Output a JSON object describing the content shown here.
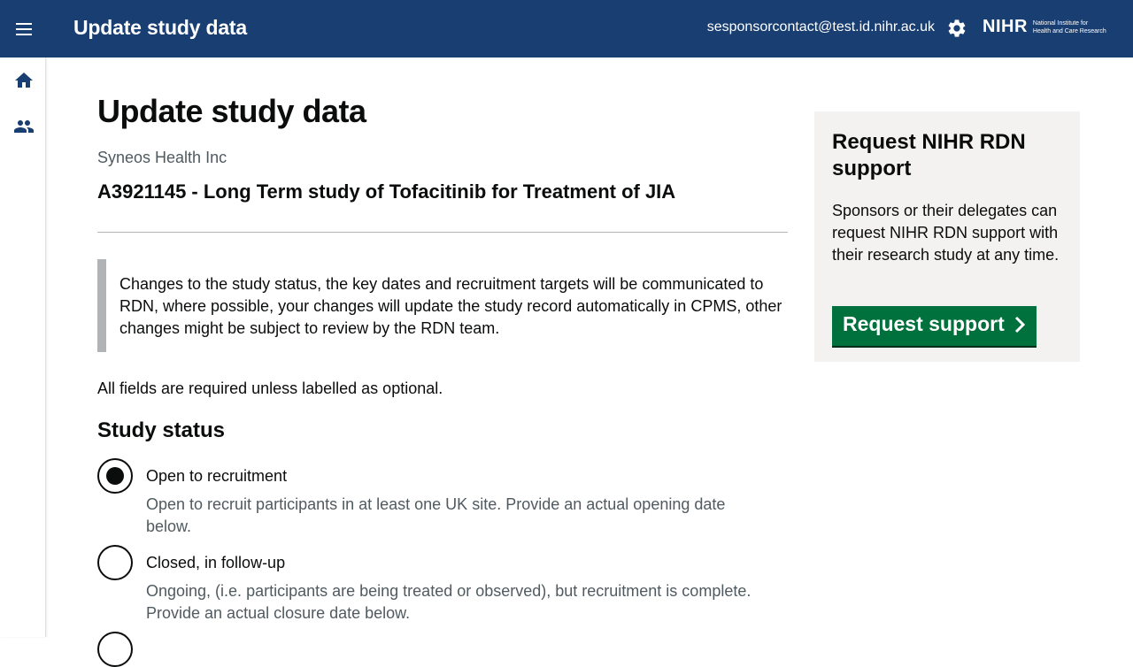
{
  "header": {
    "app_title": "Update study data",
    "user_email": "sesponsorcontact@test.id.nihr.ac.uk",
    "logo_mark": "NIHR",
    "logo_sub_line1": "National Institute for",
    "logo_sub_line2": "Health and Care Research"
  },
  "icons": {
    "menu": "menu-icon",
    "settings": "gear-icon",
    "home": "home-icon",
    "people": "people-icon",
    "chevron": "chevron-right-icon"
  },
  "main": {
    "page_title": "Update study data",
    "organisation": "Syneos Health Inc",
    "study_title": "A3921145 - Long Term study of Tofacitinib for Treatment of JIA",
    "inset_text": "Changes to the study status, the key dates and recruitment targets will be communicated to RDN, where possible, your changes will update the study record automatically in CPMS, other changes might be subject to review by the RDN team.",
    "required_note": "All fields are required unless labelled as optional.",
    "status_heading": "Study status",
    "status_options": [
      {
        "label": "Open to recruitment",
        "hint": "Open to recruit participants in at least one UK site. Provide an actual opening date below.",
        "checked": true
      },
      {
        "label": "Closed, in follow-up",
        "hint": "Ongoing, (i.e. participants are being treated or observed), but recruitment is complete. Provide an actual closure date below.",
        "checked": false
      }
    ]
  },
  "sidebar_panel": {
    "title": "Request NIHR RDN support",
    "text": "Sponsors or their delegates can request NIHR RDN support with their research study at any time.",
    "button_label": "Request support"
  },
  "colors": {
    "header_bg": "#193e72",
    "button_green": "#00703c",
    "panel_bg": "#f3f2f1",
    "hint_grey": "#505a5f"
  }
}
